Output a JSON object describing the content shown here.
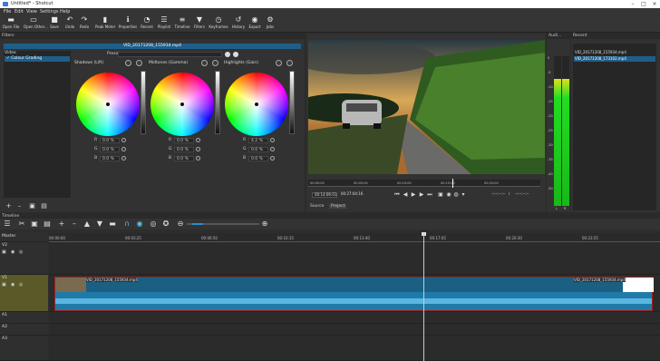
{
  "window": {
    "title": "Untitled* - Shotcut"
  },
  "menu": [
    "File",
    "Edit",
    "View",
    "Settings",
    "Help"
  ],
  "toolbar": [
    {
      "label": "Open File",
      "icon": "folder-icon"
    },
    {
      "label": "Open Other...",
      "icon": "open-other-icon"
    },
    {
      "label": "Save",
      "icon": "save-icon"
    },
    {
      "label": "Undo",
      "icon": "undo-icon"
    },
    {
      "label": "Redo",
      "icon": "redo-icon"
    },
    {
      "label": "Peak Meter",
      "icon": "peak-meter-icon"
    },
    {
      "label": "Properties",
      "icon": "info-icon"
    },
    {
      "label": "Recent",
      "icon": "clock-icon"
    },
    {
      "label": "Playlist",
      "icon": "playlist-icon"
    },
    {
      "label": "Timeline",
      "icon": "timeline-icon"
    },
    {
      "label": "Filters",
      "icon": "filter-icon"
    },
    {
      "label": "Keyframes",
      "icon": "stopwatch-icon"
    },
    {
      "label": "History",
      "icon": "history-icon"
    },
    {
      "label": "Export",
      "icon": "export-icon"
    },
    {
      "label": "Jobs",
      "icon": "jobs-icon"
    }
  ],
  "filters": {
    "panel_title": "Filters",
    "clip_name": "VID_20171208_155934.mp4",
    "list_header": "Video",
    "items": [
      "✓ Colour Grading"
    ],
    "preset_label": "Preset",
    "wheels": [
      {
        "label": "Shadows (Lift)",
        "r": "0.0 %",
        "g": "0.0 %",
        "b": "0.0 %"
      },
      {
        "label": "Midtones (Gamma)",
        "r": "0.0 %",
        "g": "0.0 %",
        "b": "0.0 %"
      },
      {
        "label": "Highlights (Gain)",
        "r": "4.2 %",
        "g": "0.0 %",
        "b": "0.0 %"
      }
    ],
    "channel_keys": [
      "R",
      "G",
      "B"
    ]
  },
  "player": {
    "ruler_ticks": [
      "00:00:00",
      "00:05:00",
      "00:10:00",
      "00:15:00",
      "00:20:00"
    ],
    "position": "00:14:06:01",
    "duration": "00:27:04:16",
    "in_point": "--:--:--:--",
    "in_out_sep": "/",
    "out_point": "--:--:--:--",
    "tabs": [
      "Source",
      "Project"
    ]
  },
  "audio": {
    "title": "Audi...",
    "scale": [
      "0",
      "-5",
      "-10",
      "-15",
      "-20",
      "-25",
      "-30",
      "-35",
      "-40",
      "-50"
    ],
    "channels": [
      "L",
      "R"
    ],
    "levels": [
      0.85,
      0.85
    ]
  },
  "recent": {
    "title": "Recent",
    "items": [
      "VID_20171208_155934.mp4",
      "VID_20171208_173102.mp4"
    ]
  },
  "timeline": {
    "title": "Timeline",
    "ruler": [
      "00:00:00",
      "00:03:25",
      "00:06:50",
      "00:10:15",
      "00:13:40",
      "00:17:05",
      "00:20:30",
      "00:23:55"
    ],
    "tracks": [
      "Master",
      "V2",
      "V1",
      "A1",
      "A2",
      "A3"
    ],
    "clip_label": "VID_20171208_155934.mp4",
    "clip_label_end": "VID_20171208_155934.mp4"
  }
}
